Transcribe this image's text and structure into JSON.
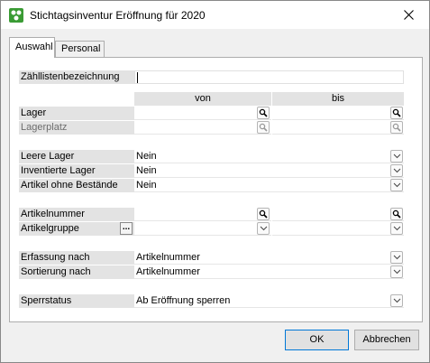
{
  "window": {
    "title": "Stichtagsinventur Eröffnung für 2020"
  },
  "tabs": [
    {
      "label": "Auswahl"
    },
    {
      "label": "Personal"
    }
  ],
  "form": {
    "zaehllisten_label": "Zähllistenbezeichnung",
    "zaehllisten_value": "",
    "col_von": "von",
    "col_bis": "bis",
    "lager_label": "Lager",
    "lagerplatz_label": "Lagerplatz",
    "leere_lager_label": "Leere Lager",
    "leere_lager_value": "Nein",
    "inventierte_label": "Inventierte Lager",
    "inventierte_value": "Nein",
    "ohne_bestaende_label": "Artikel ohne Bestände",
    "ohne_bestaende_value": "Nein",
    "artikelnummer_label": "Artikelnummer",
    "artikelgruppe_label": "Artikelgruppe",
    "artikelgruppe_dots": "...",
    "erfassung_label": "Erfassung nach",
    "erfassung_value": "Artikelnummer",
    "sortierung_label": "Sortierung nach",
    "sortierung_value": "Artikelnummer",
    "sperrstatus_label": "Sperrstatus",
    "sperrstatus_value": "Ab Eröffnung sperren"
  },
  "footer": {
    "ok_label": "OK",
    "cancel_label": "Abbrechen"
  },
  "icons": {
    "lookup": "magnifier-icon",
    "dropdown": "chevron-down-icon",
    "close": "close-icon",
    "app": "app-icon"
  }
}
